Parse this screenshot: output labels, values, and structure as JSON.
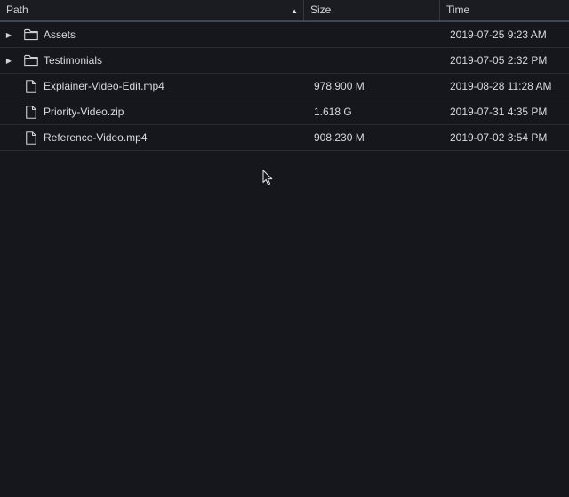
{
  "columns": {
    "path": "Path",
    "size": "Size",
    "time": "Time",
    "sort_indicator": "▲"
  },
  "rows": [
    {
      "type": "folder",
      "expander": "▶",
      "name": "Assets",
      "size": "",
      "time": "2019-07-25 9:23 AM",
      "icon": "folder-icon"
    },
    {
      "type": "folder",
      "expander": "▶",
      "name": "Testimonials",
      "size": "",
      "time": "2019-07-05 2:32 PM",
      "icon": "folder-icon"
    },
    {
      "type": "file",
      "expander": "",
      "name": "Explainer-Video-Edit.mp4",
      "size": "978.900 M",
      "time": "2019-08-28 11:28 AM",
      "icon": "file-icon"
    },
    {
      "type": "file",
      "expander": "",
      "name": "Priority-Video.zip",
      "size": "1.618 G",
      "time": "2019-07-31 4:35 PM",
      "icon": "file-icon"
    },
    {
      "type": "file",
      "expander": "",
      "name": "Reference-Video.mp4",
      "size": "908.230 M",
      "time": "2019-07-02 3:54 PM",
      "icon": "file-icon"
    }
  ],
  "colors": {
    "background": "#16171d",
    "header_border": "#3d4654",
    "text": "#d8dade"
  }
}
